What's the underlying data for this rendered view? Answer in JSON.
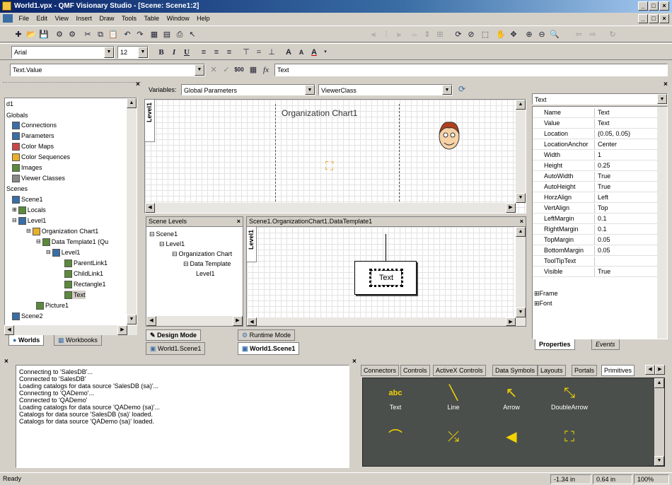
{
  "window": {
    "title": "World1.vpx - QMF Visionary Studio - [Scene: Scene1:2]"
  },
  "menu": [
    "File",
    "Edit",
    "View",
    "Insert",
    "Draw",
    "Tools",
    "Table",
    "Window",
    "Help"
  ],
  "format_bar": {
    "font": "Arial",
    "size": "12",
    "bold": "B",
    "italic": "I",
    "underline": "U"
  },
  "formula_bar": {
    "property": "Text.Value",
    "fx": "fx",
    "value": "Text"
  },
  "variables_bar": {
    "label": "Variables:",
    "scope": "Global Parameters",
    "class": "ViewerClass"
  },
  "tree": {
    "items": [
      {
        "label": "d1"
      },
      {
        "label": "Globals"
      },
      {
        "label": "Connections"
      },
      {
        "label": "Parameters"
      },
      {
        "label": "Color Maps"
      },
      {
        "label": "Color Sequences"
      },
      {
        "label": "Images"
      },
      {
        "label": "Viewer Classes"
      },
      {
        "label": "Scenes"
      },
      {
        "label": "Scene1"
      },
      {
        "label": "Locals"
      },
      {
        "label": "Level1"
      },
      {
        "label": "Organization Chart1"
      },
      {
        "label": "Data Template1 (Qu"
      },
      {
        "label": "Level1"
      },
      {
        "label": "ParentLink1"
      },
      {
        "label": "ChildLink1"
      },
      {
        "label": "Rectangle1"
      },
      {
        "label": "Text"
      },
      {
        "label": "Picture1"
      },
      {
        "label": "Scene2"
      }
    ],
    "tabs": {
      "worlds": "Worlds",
      "workbooks": "Workbooks"
    }
  },
  "canvas": {
    "level_tab": "Level1",
    "org_chart_label": "Organization Chart1"
  },
  "scene_levels": {
    "title": "Scene Levels",
    "items": [
      {
        "label": "Scene1"
      },
      {
        "label": "Level1"
      },
      {
        "label": "Organization Chart"
      },
      {
        "label": "Data Template"
      },
      {
        "label": "Level1"
      }
    ]
  },
  "template_pane": {
    "title": "Scene1.OrganizationChart1.DataTemplate1",
    "level_tab": "Level1",
    "text_box": "Text"
  },
  "mode_tabs": {
    "design": "Design Mode",
    "runtime": "Runtime Mode"
  },
  "doc_tabs": {
    "tab1": "World1.Scene1",
    "tab2": "World1.Scene1"
  },
  "properties": {
    "selected": "Text",
    "rows": [
      {
        "k": "Name",
        "v": "Text"
      },
      {
        "k": "Value",
        "v": "Text"
      },
      {
        "k": "Location",
        "v": "(0.05, 0.05)"
      },
      {
        "k": "LocationAnchor",
        "v": "Center"
      },
      {
        "k": "Width",
        "v": "1"
      },
      {
        "k": "Height",
        "v": "0.25"
      },
      {
        "k": "AutoWidth",
        "v": "True"
      },
      {
        "k": "AutoHeight",
        "v": "True"
      },
      {
        "k": "HorzAlign",
        "v": "Left"
      },
      {
        "k": "VertAlign",
        "v": "Top"
      },
      {
        "k": "LeftMargin",
        "v": "0.1"
      },
      {
        "k": "RightMargin",
        "v": "0.1"
      },
      {
        "k": "TopMargin",
        "v": "0.05"
      },
      {
        "k": "BottomMargin",
        "v": "0.05"
      },
      {
        "k": "ToolTipText",
        "v": ""
      },
      {
        "k": "Visible",
        "v": "True"
      }
    ],
    "groups": [
      "Frame",
      "Font"
    ],
    "tabs": {
      "properties": "Properties",
      "events": "Events"
    }
  },
  "log": [
    "Connecting to 'SalesDB'...",
    "Connected to 'SalesDB'",
    "Loading catalogs for data source 'SalesDB (sa)'...",
    "Connecting to 'QADemo'...",
    "Connected to 'QADemo'",
    "Loading catalogs for data source 'QADemo (sa)'...",
    "Catalogs for data source 'SalesDB (sa)' loaded.",
    "Catalogs for data source 'QADemo (sa)' loaded."
  ],
  "toolbox": {
    "tabs": [
      "Connectors",
      "Controls",
      "ActiveX Controls",
      "Data Symbols",
      "Layouts",
      "Portals",
      "Primitives"
    ],
    "primitives": [
      {
        "label": "Text",
        "icon": "abc-icon"
      },
      {
        "label": "Line",
        "icon": "line-icon"
      },
      {
        "label": "Arrow",
        "icon": "arrow-icon"
      },
      {
        "label": "DoubleArrow",
        "icon": "double-arrow-icon"
      },
      {
        "label": "",
        "icon": "polyline-icon"
      },
      {
        "label": "",
        "icon": "multipolyline-icon"
      },
      {
        "label": "",
        "icon": "polygon-icon"
      },
      {
        "label": "",
        "icon": "multipolygon-icon"
      }
    ]
  },
  "status": {
    "text": "Ready",
    "x": "-1.34 in",
    "y": "0.64 in",
    "zoom": "100%"
  }
}
